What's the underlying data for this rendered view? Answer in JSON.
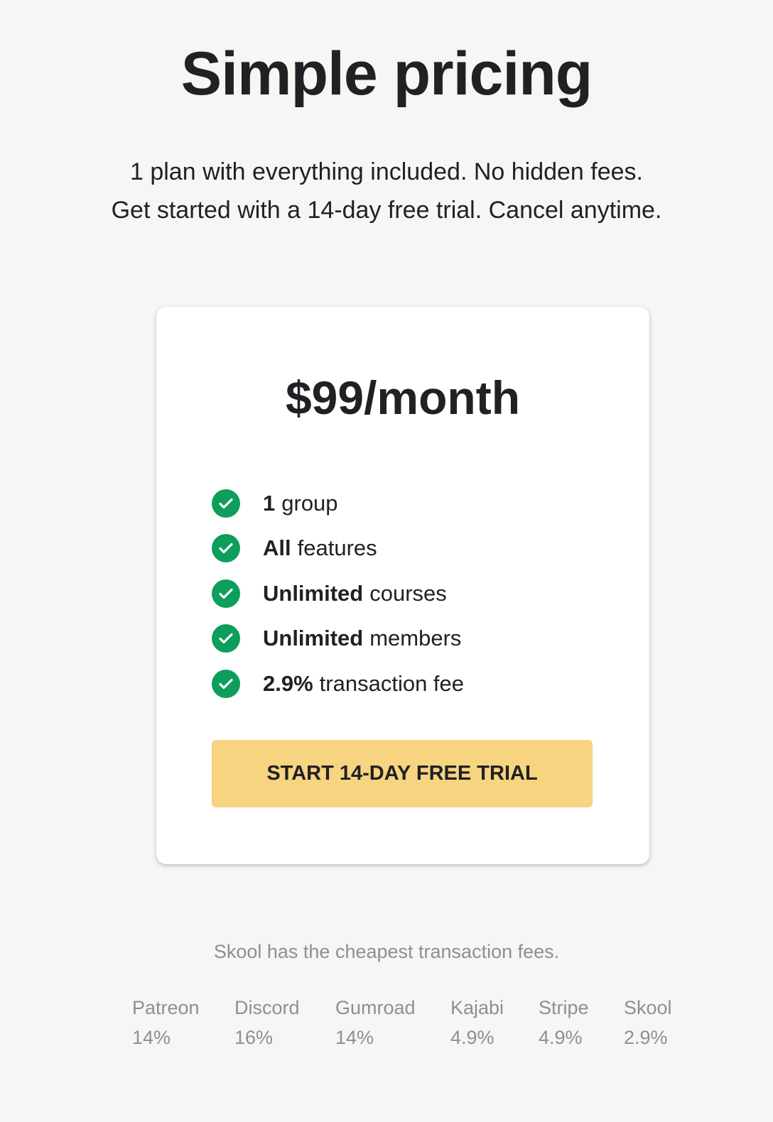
{
  "header": {
    "title": "Simple pricing",
    "subtitle_line1": "1 plan with everything included. No hidden fees.",
    "subtitle_line2": "Get started with a 14-day free trial. Cancel anytime."
  },
  "plan": {
    "price": "$99/month",
    "features": [
      {
        "bold": "1",
        "text": "group"
      },
      {
        "bold": "All",
        "text": "features"
      },
      {
        "bold": "Unlimited",
        "text": "courses"
      },
      {
        "bold": "Unlimited",
        "text": "members"
      },
      {
        "bold": "2.9%",
        "text": "transaction fee"
      }
    ],
    "cta_label": "START 14-DAY FREE TRIAL"
  },
  "comparison": {
    "note": "Skool has the cheapest transaction fees.",
    "platforms": [
      {
        "name": "Patreon",
        "fee": "14%"
      },
      {
        "name": "Discord",
        "fee": "16%"
      },
      {
        "name": "Gumroad",
        "fee": "14%"
      },
      {
        "name": "Kajabi",
        "fee": "4.9%"
      },
      {
        "name": "Stripe",
        "fee": "4.9%"
      },
      {
        "name": "Skool",
        "fee": "2.9%"
      }
    ]
  },
  "colors": {
    "check": "#0c9e5a",
    "cta": "#f7d47f",
    "background": "#f7f6f4"
  }
}
